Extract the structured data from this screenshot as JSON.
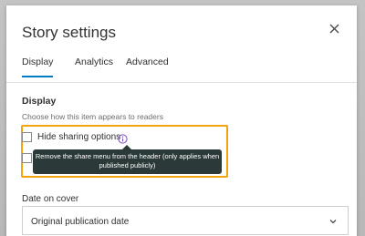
{
  "dialog": {
    "title": "Story settings",
    "close_icon": "close-icon"
  },
  "tabs": [
    {
      "label": "Display",
      "active": true
    },
    {
      "label": "Analytics",
      "active": false
    },
    {
      "label": "Advanced",
      "active": false
    }
  ],
  "display_section": {
    "heading": "Display",
    "description": "Choose how this item appears to readers",
    "options": [
      {
        "label": "Hide sharing options",
        "checked": false,
        "icon": "info-icon"
      },
      {
        "label": "",
        "checked": false
      }
    ],
    "tooltip": "Remove the share menu from the header (only applies when published publicly)"
  },
  "date_on_cover": {
    "label": "Date on cover",
    "selected": "Original publication date",
    "icon": "chevron-down-icon"
  },
  "colors": {
    "accent": "#007ac2",
    "highlight": "#f2a30f",
    "tooltip_bg": "#2b3a38"
  }
}
